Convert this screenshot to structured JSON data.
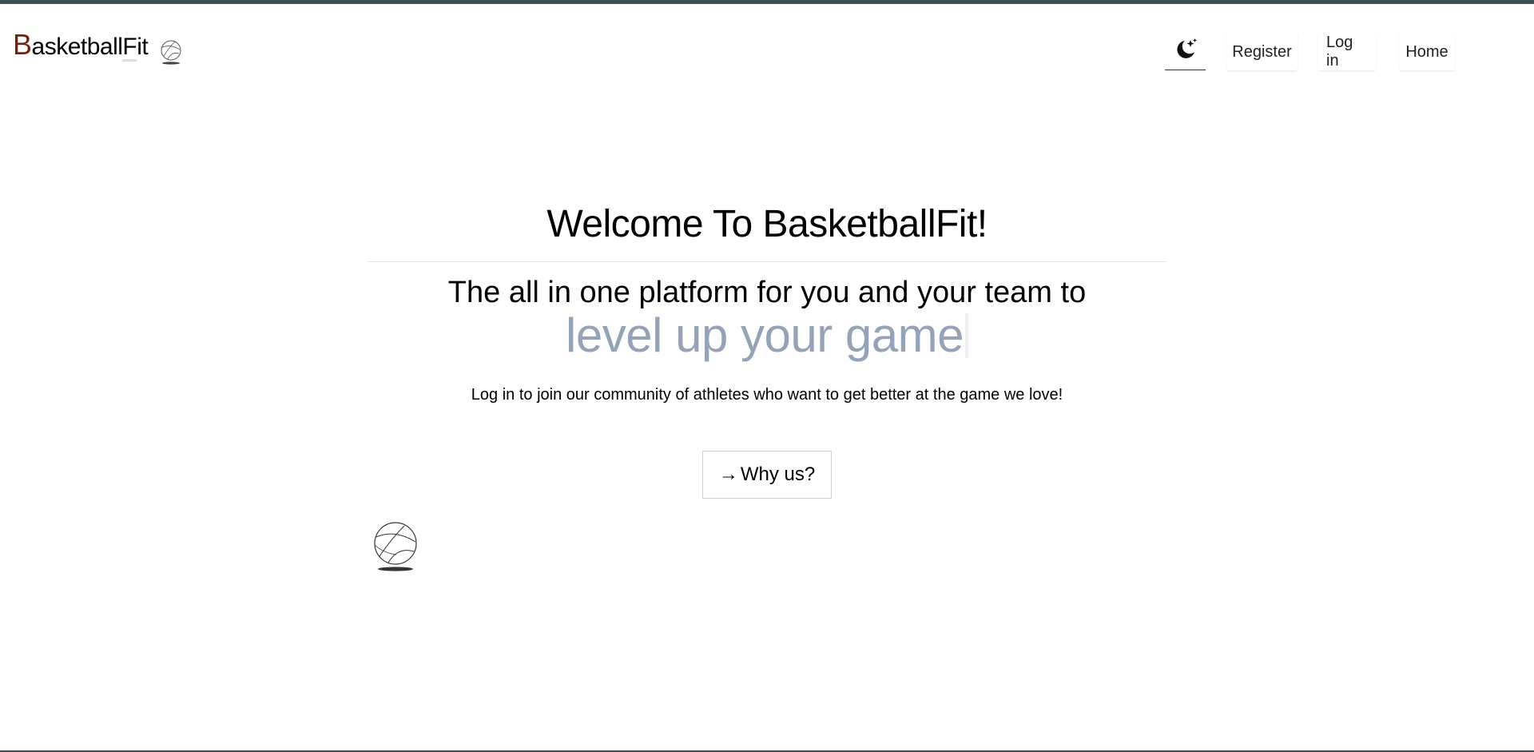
{
  "header": {
    "logo": {
      "first_letter": "B",
      "middle": "asketball",
      "f_letter": "F",
      "end": "it"
    },
    "nav": {
      "register_label": "Register",
      "login_label": "Log in",
      "home_label": "Home"
    }
  },
  "hero": {
    "title": "Welcome To BasketballFit!",
    "subtitle": "The all in one platform for you and your team to",
    "typed_text": "level up your game",
    "description": "Log in to join our community of athletes who want to get better at the game we love!",
    "cta_arrow": "→",
    "cta_label": "Why us?"
  },
  "colors": {
    "logo_accent": "#7a1e0e",
    "typed_text": "#94a3b8",
    "top_strip": "#3f4f57"
  },
  "icons": [
    "basketball-icon",
    "moon-stars-icon",
    "arrow-right-icon"
  ]
}
